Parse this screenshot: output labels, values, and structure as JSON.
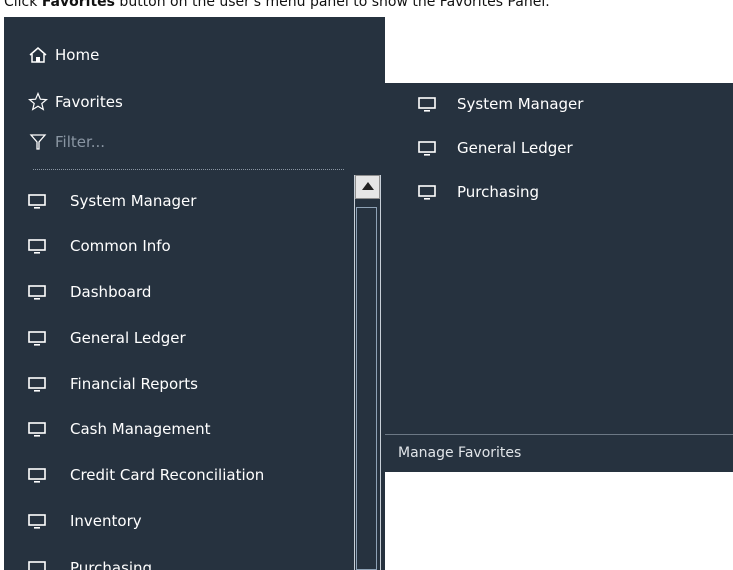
{
  "instruction": {
    "prefix": "Click ",
    "bold": "Favorites",
    "suffix": " button on the user's menu panel to show the Favorites Panel."
  },
  "menu": {
    "home_label": "Home",
    "favorites_label": "Favorites",
    "filter_placeholder": "Filter...",
    "items": [
      {
        "label": "System Manager",
        "icon": "monitor-icon"
      },
      {
        "label": "Common Info",
        "icon": "monitor-icon"
      },
      {
        "label": "Dashboard",
        "icon": "monitor-icon"
      },
      {
        "label": "General Ledger",
        "icon": "monitor-icon"
      },
      {
        "label": "Financial Reports",
        "icon": "monitor-icon"
      },
      {
        "label": "Cash Management",
        "icon": "monitor-icon"
      },
      {
        "label": "Credit Card Reconciliation",
        "icon": "monitor-icon"
      },
      {
        "label": "Inventory",
        "icon": "monitor-icon"
      },
      {
        "label": "Purchasing",
        "icon": "monitor-icon"
      }
    ]
  },
  "favorites_panel": {
    "items": [
      {
        "label": "System Manager",
        "icon": "monitor-icon"
      },
      {
        "label": "General Ledger",
        "icon": "monitor-icon"
      },
      {
        "label": "Purchasing",
        "icon": "monitor-icon"
      }
    ],
    "footer_label": "Manage Favorites"
  },
  "colors": {
    "panel_bg": "#26323f",
    "text": "#ffffff",
    "muted_text": "#8a96a3"
  }
}
